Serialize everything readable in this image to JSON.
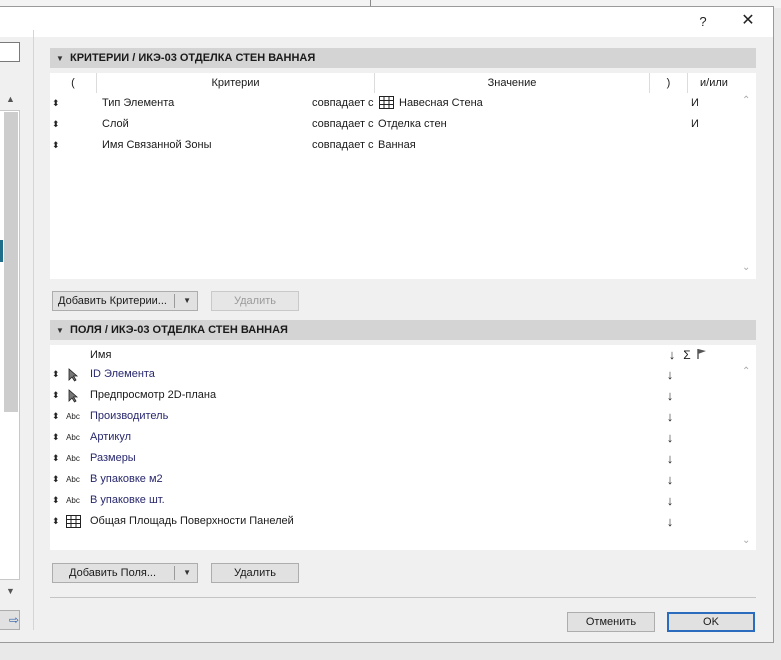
{
  "dialog": {
    "help_label": "?",
    "close_label": "✕"
  },
  "criteria": {
    "title": "КРИТЕРИИ / ИКЭ-03 ОТДЕЛКА СТЕН ВАННАЯ",
    "columns": {
      "open_paren": "(",
      "criteria": "Критерии",
      "value": "Значение",
      "close_paren": ")",
      "andor": "и/или"
    },
    "rows": [
      {
        "name": "Тип Элемента",
        "operator": "совпадает с",
        "value_icon": "curtain-wall-icon",
        "value": "Навесная Стена",
        "andor": "И"
      },
      {
        "name": "Слой",
        "operator": "совпадает с",
        "value_icon": "",
        "value": "Отделка стен",
        "andor": "И"
      },
      {
        "name": "Имя Связанной Зоны",
        "operator": "совпадает с",
        "value_icon": "",
        "value": "Ванная",
        "andor": ""
      }
    ],
    "add_button": "Добавить Критерии...",
    "delete_button": "Удалить"
  },
  "fields": {
    "title": "ПОЛЯ / ИКЭ-03 ОТДЕЛКА СТЕН ВАННАЯ",
    "columns": {
      "name": "Имя",
      "sort": "↓",
      "sum": "Σ"
    },
    "rows": [
      {
        "icon": "pointer-icon",
        "icon_text": "",
        "label": "ID Элемента",
        "blue": true,
        "sort": "↓"
      },
      {
        "icon": "pointer-icon",
        "icon_text": "",
        "label": "Предпросмотр 2D-плана",
        "blue": false,
        "sort": "↓"
      },
      {
        "icon": "abc-icon",
        "icon_text": "Abc",
        "label": "Производитель",
        "blue": true,
        "sort": "↓"
      },
      {
        "icon": "abc-icon",
        "icon_text": "Abc",
        "label": "Артикул",
        "blue": true,
        "sort": "↓"
      },
      {
        "icon": "abc-icon",
        "icon_text": "Abc",
        "label": "Размеры",
        "blue": true,
        "sort": "↓"
      },
      {
        "icon": "abc-icon",
        "icon_text": "Abc",
        "label": "В упаковке м2",
        "blue": true,
        "sort": "↓"
      },
      {
        "icon": "abc-icon",
        "icon_text": "Abc",
        "label": "В упаковке шт.",
        "blue": true,
        "sort": "↓"
      },
      {
        "icon": "curtain-wall-icon",
        "icon_text": "",
        "label": "Общая Площадь Поверхности Панелей",
        "blue": false,
        "sort": "↓"
      }
    ],
    "add_button": "Добавить Поля...",
    "delete_button": "Удалить"
  },
  "footer": {
    "cancel_button": "Отменить",
    "ok_button": "OK"
  },
  "colors": {
    "link_text": "#27276e",
    "ok_border": "#2b6cbf",
    "header_bg": "#d4d4d4"
  }
}
